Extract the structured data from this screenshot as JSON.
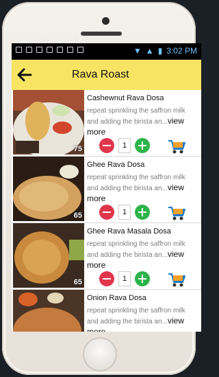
{
  "status": {
    "time": "3:02 PM"
  },
  "appbar": {
    "title": "Rava Roast"
  },
  "items": [
    {
      "name": "Cashewnut Rava Dosa",
      "desc": "repeat sprinkling the saffron milk and adding the birista an...",
      "more": "view more",
      "price": "75",
      "qty": "1"
    },
    {
      "name": "Ghee Rava Dosa",
      "desc": "repeat sprinkling the saffron milk and adding the birista an...",
      "more": "view more",
      "price": "65",
      "qty": "1"
    },
    {
      "name": "Ghee Rava Masala Dosa",
      "desc": "repeat sprinkling the saffron milk and adding the birista an...",
      "more": "view more",
      "price": "65",
      "qty": "1"
    },
    {
      "name": "Onion Rava Dosa",
      "desc": "repeat sprinkling the saffron milk and adding the birista an...",
      "more": "view more",
      "price": "",
      "qty": ""
    }
  ],
  "icons": {
    "back": "back-arrow-icon",
    "cart": "cart-icon",
    "minus": "minus-icon",
    "plus": "plus-icon"
  },
  "colors": {
    "appbar": "#f7e463",
    "minus": "#e0354b",
    "plus": "#2cb44a"
  }
}
